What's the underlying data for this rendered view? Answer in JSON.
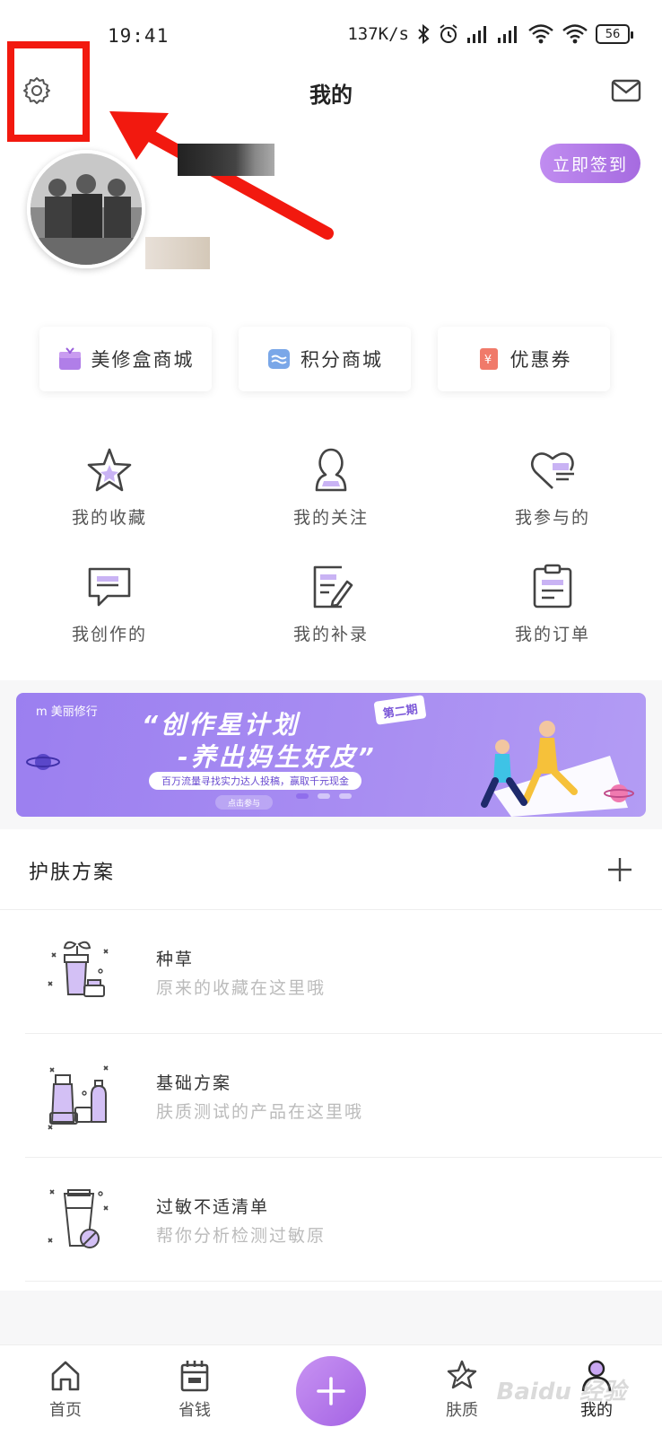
{
  "status_bar": {
    "time": "19:41",
    "speed": "137K/s",
    "battery": "56"
  },
  "header": {
    "title": "我的",
    "checkin_label": "立即签到"
  },
  "shops": [
    {
      "label": "美修盒商城",
      "icon": "gift-icon",
      "color": "#b07ee8"
    },
    {
      "label": "积分商城",
      "icon": "points-icon",
      "color": "#7aa7e8"
    },
    {
      "label": "优惠券",
      "icon": "coupon-icon",
      "color": "#f07a6a"
    }
  ],
  "grid": [
    {
      "label": "我的收藏",
      "icon": "star-icon"
    },
    {
      "label": "我的关注",
      "icon": "person-icon"
    },
    {
      "label": "我参与的",
      "icon": "heart-icon"
    },
    {
      "label": "我创作的",
      "icon": "chat-icon"
    },
    {
      "label": "我的补录",
      "icon": "edit-icon"
    },
    {
      "label": "我的订单",
      "icon": "clipboard-icon"
    }
  ],
  "banner": {
    "brand": "m 美丽修行",
    "title1": "“创作星计划",
    "title2": "-养出妈生好皮”",
    "tag": "第二期",
    "pill": "百万流量寻找实力达人投稿，赢取千元现金",
    "cta": "点击参与"
  },
  "skin_plan": {
    "title": "护肤方案",
    "items": [
      {
        "name": "种草",
        "desc": "原来的收藏在这里哦"
      },
      {
        "name": "基础方案",
        "desc": "肤质测试的产品在这里哦"
      },
      {
        "name": "过敏不适清单",
        "desc": "帮你分析检测过敏原"
      }
    ]
  },
  "nav": [
    {
      "label": "首页",
      "icon": "home-icon"
    },
    {
      "label": "省钱",
      "icon": "calendar-icon"
    },
    {
      "label": "肤质",
      "icon": "skin-icon"
    },
    {
      "label": "我的",
      "icon": "profile-icon"
    }
  ],
  "watermark": "Baidu 经验",
  "colors": {
    "accent": "#a66be0",
    "highlight": "#f2190f"
  }
}
